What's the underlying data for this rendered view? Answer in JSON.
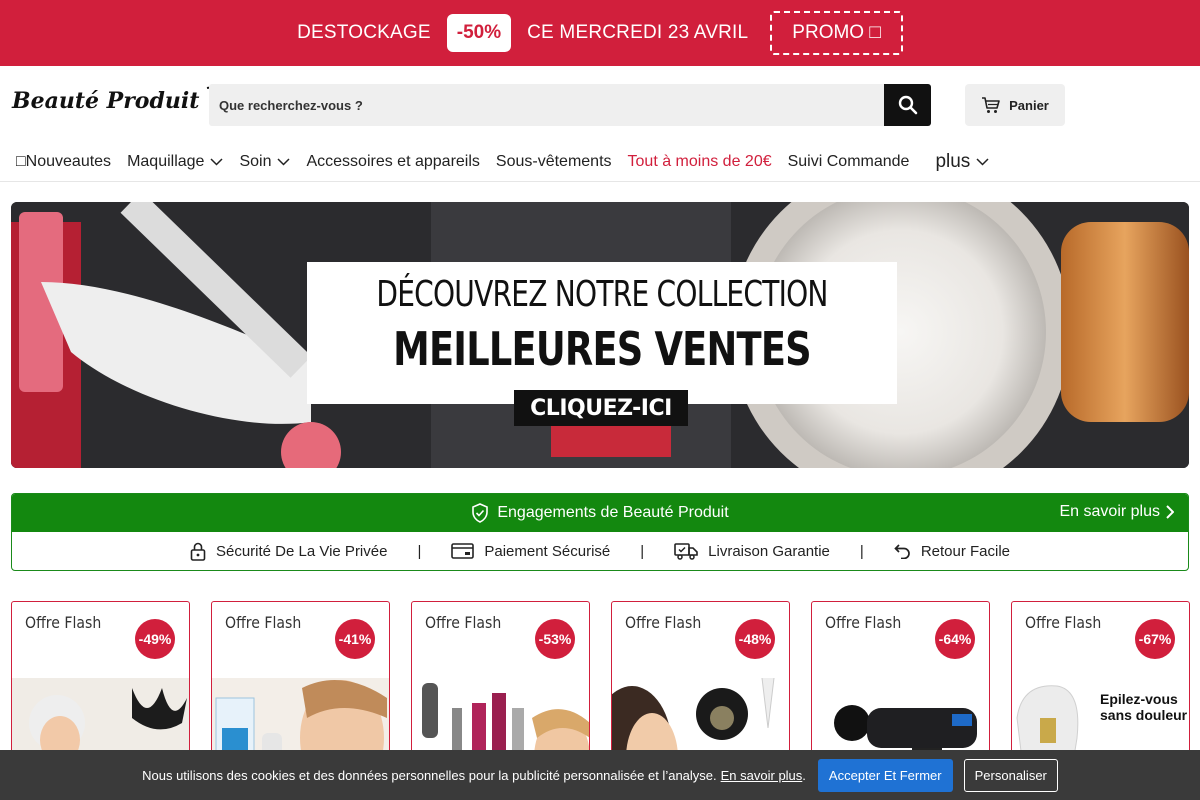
{
  "promo": {
    "text_left": "DESTOCKAGE",
    "badge": "-50%",
    "text_right": "CE MERCREDI 23 AVRIL",
    "button": "PROMO □"
  },
  "header": {
    "logo_text": "Beauté Produit",
    "search_placeholder": "Que recherchez-vous ?",
    "cart_label": "Panier"
  },
  "nav": {
    "items": [
      {
        "label": "□Nouveautes"
      },
      {
        "label": "Maquillage"
      },
      {
        "label": "Soin"
      },
      {
        "label": "Accessoires et appareils"
      },
      {
        "label": "Sous-vêtements"
      },
      {
        "label": "Tout à moins de 20€"
      },
      {
        "label": "Suivi Commande"
      },
      {
        "label": "plus"
      }
    ]
  },
  "hero": {
    "line1": "DÉCOUVREZ NOTRE COLLECTION",
    "line2": "MEILLEURES VENTES",
    "cta": "CLIQUEZ-ICI"
  },
  "engagements": {
    "title": "Engagements de Beauté Produit",
    "more": "En savoir plus",
    "items": [
      {
        "label": "Sécurité De La Vie Privée",
        "icon": "lock-icon"
      },
      {
        "label": "Paiement Sécurisé",
        "icon": "card-icon"
      },
      {
        "label": "Livraison Garantie",
        "icon": "truck-icon"
      },
      {
        "label": "Retour Facile",
        "icon": "return-icon"
      }
    ],
    "separator": "|"
  },
  "products": [
    {
      "label": "Offre Flash",
      "discount": "-49%"
    },
    {
      "label": "Offre Flash",
      "discount": "-41%"
    },
    {
      "label": "Offre Flash",
      "discount": "-53%"
    },
    {
      "label": "Offre Flash",
      "discount": "-48%"
    },
    {
      "label": "Offre Flash",
      "discount": "-64%"
    },
    {
      "label": "Offre Flash",
      "discount": "-67%",
      "image_text_1": "Epilez-vous",
      "image_text_2": "sans douleur"
    }
  ],
  "cookie": {
    "text": "Nous utilisons des cookies et des données personnelles pour la publicité personnalisée et l’analyse.",
    "link": "En savoir plus",
    "period": ".",
    "accept": "Accepter Et Fermer",
    "customize": "Personaliser"
  },
  "colors": {
    "brand_red": "#d11f3c",
    "green": "#13880f",
    "cookie_bg": "#3a3a3a",
    "accept_blue": "#1f72d4"
  }
}
